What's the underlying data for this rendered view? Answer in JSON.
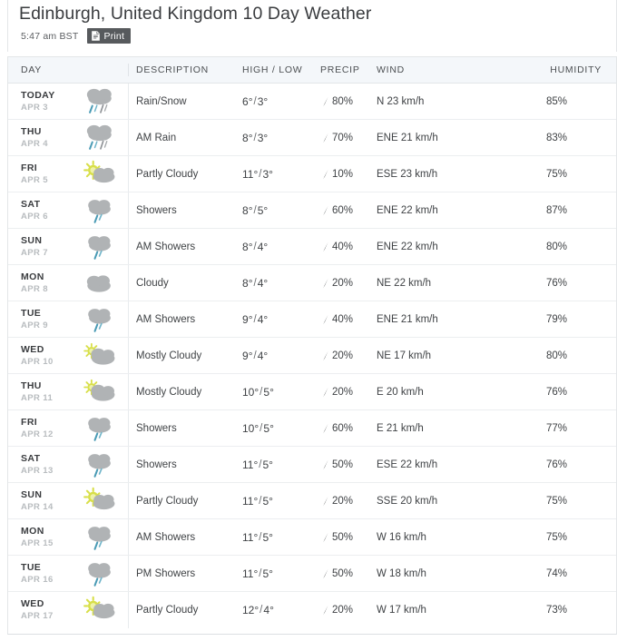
{
  "header": {
    "title": "Edinburgh, United Kingdom 10 Day Weather",
    "timestamp": "5:47 am BST",
    "print_label": "Print"
  },
  "colors": {
    "header_bg": "#f4f7fa",
    "text": "#3f4245",
    "muted": "#b8bcbf",
    "print_button_bg": "#575a5d",
    "cloud": "#b0b3b5",
    "sun": "#d8df4a",
    "rain": "#4a9bb5"
  },
  "table": {
    "columns": [
      {
        "key": "day",
        "label": "DAY"
      },
      {
        "key": "description",
        "label": "DESCRIPTION"
      },
      {
        "key": "temp",
        "label": "HIGH / LOW"
      },
      {
        "key": "precip",
        "label": "PRECIP"
      },
      {
        "key": "wind",
        "label": "WIND"
      },
      {
        "key": "humidity",
        "label": "HUMIDITY"
      }
    ],
    "rows": [
      {
        "day": "TODAY",
        "date": "APR 3",
        "icon": "rain-snow-icon",
        "description": "Rain/Snow",
        "high": "6",
        "low": "3",
        "precip": "80%",
        "wind": "N 23 km/h",
        "humidity": "85%"
      },
      {
        "day": "THU",
        "date": "APR 4",
        "icon": "rain-snow-icon",
        "description": "AM Rain",
        "high": "8",
        "low": "3",
        "precip": "70%",
        "wind": "ENE 21 km/h",
        "humidity": "83%"
      },
      {
        "day": "FRI",
        "date": "APR 5",
        "icon": "partly-cloudy-icon",
        "description": "Partly Cloudy",
        "high": "11",
        "low": "3",
        "precip": "10%",
        "wind": "ESE 23 km/h",
        "humidity": "75%"
      },
      {
        "day": "SAT",
        "date": "APR 6",
        "icon": "showers-icon",
        "description": "Showers",
        "high": "8",
        "low": "5",
        "precip": "60%",
        "wind": "ENE 22 km/h",
        "humidity": "87%"
      },
      {
        "day": "SUN",
        "date": "APR 7",
        "icon": "showers-icon",
        "description": "AM Showers",
        "high": "8",
        "low": "4",
        "precip": "40%",
        "wind": "ENE 22 km/h",
        "humidity": "80%"
      },
      {
        "day": "MON",
        "date": "APR 8",
        "icon": "cloudy-icon",
        "description": "Cloudy",
        "high": "8",
        "low": "4",
        "precip": "20%",
        "wind": "NE 22 km/h",
        "humidity": "76%"
      },
      {
        "day": "TUE",
        "date": "APR 9",
        "icon": "showers-icon",
        "description": "AM Showers",
        "high": "9",
        "low": "4",
        "precip": "40%",
        "wind": "ENE 21 km/h",
        "humidity": "79%"
      },
      {
        "day": "WED",
        "date": "APR 10",
        "icon": "mostly-cloudy-icon",
        "description": "Mostly Cloudy",
        "high": "9",
        "low": "4",
        "precip": "20%",
        "wind": "NE 17 km/h",
        "humidity": "80%"
      },
      {
        "day": "THU",
        "date": "APR 11",
        "icon": "mostly-cloudy-icon",
        "description": "Mostly Cloudy",
        "high": "10",
        "low": "5",
        "precip": "20%",
        "wind": "E 20 km/h",
        "humidity": "76%"
      },
      {
        "day": "FRI",
        "date": "APR 12",
        "icon": "showers-icon",
        "description": "Showers",
        "high": "10",
        "low": "5",
        "precip": "60%",
        "wind": "E 21 km/h",
        "humidity": "77%"
      },
      {
        "day": "SAT",
        "date": "APR 13",
        "icon": "showers-icon",
        "description": "Showers",
        "high": "11",
        "low": "5",
        "precip": "50%",
        "wind": "ESE 22 km/h",
        "humidity": "76%"
      },
      {
        "day": "SUN",
        "date": "APR 14",
        "icon": "partly-cloudy-icon",
        "description": "Partly Cloudy",
        "high": "11",
        "low": "5",
        "precip": "20%",
        "wind": "SSE 20 km/h",
        "humidity": "75%"
      },
      {
        "day": "MON",
        "date": "APR 15",
        "icon": "showers-icon",
        "description": "AM Showers",
        "high": "11",
        "low": "5",
        "precip": "50%",
        "wind": "W 16 km/h",
        "humidity": "75%"
      },
      {
        "day": "TUE",
        "date": "APR 16",
        "icon": "showers-icon",
        "description": "PM Showers",
        "high": "11",
        "low": "5",
        "precip": "50%",
        "wind": "W 18 km/h",
        "humidity": "74%"
      },
      {
        "day": "WED",
        "date": "APR 17",
        "icon": "partly-cloudy-icon",
        "description": "Partly Cloudy",
        "high": "12",
        "low": "4",
        "precip": "20%",
        "wind": "W 17 km/h",
        "humidity": "73%"
      }
    ]
  }
}
